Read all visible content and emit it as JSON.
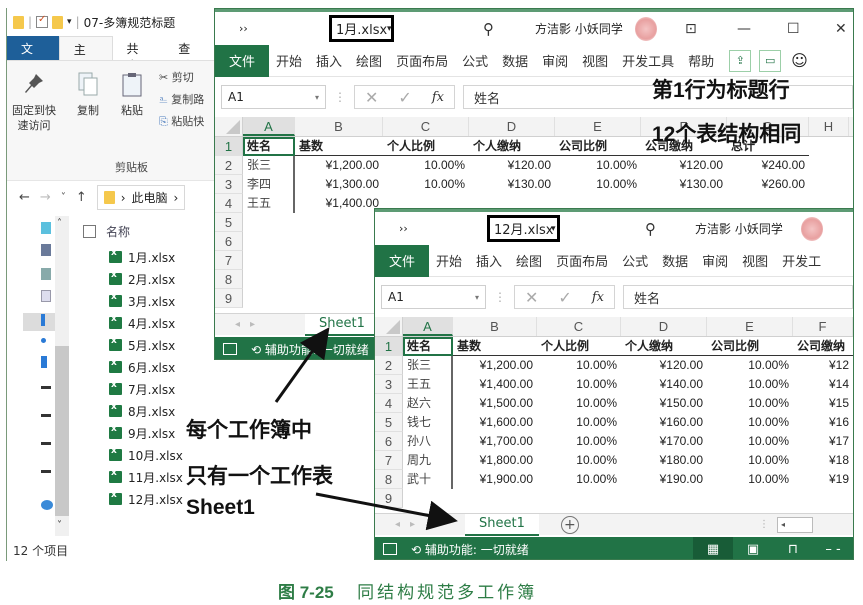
{
  "explorer": {
    "title": "07-多簿规范标题",
    "tabs": [
      "文件",
      "主页",
      "共享",
      "查看"
    ],
    "ribbon": {
      "pin_label_line1": "固定到快",
      "pin_label_line2": "速访问",
      "copy_label": "复制",
      "paste_label": "粘贴",
      "cut_label": "剪切",
      "copy_path_label": "复制路",
      "paste_shortcut_label": "粘贴快",
      "group_label": "剪贴板"
    },
    "nav": {
      "back": "←",
      "forward": "→",
      "recent": "˅",
      "up": "↑",
      "path_item": "此电脑",
      "sep": "›"
    },
    "list_header": "名称",
    "files": [
      "1月.xlsx",
      "2月.xlsx",
      "3月.xlsx",
      "4月.xlsx",
      "5月.xlsx",
      "6月.xlsx",
      "7月.xlsx",
      "8月.xlsx",
      "9月.xlsx",
      "10月.xlsx",
      "11月.xlsx",
      "12月.xlsx"
    ],
    "status": "12 个项目"
  },
  "workbook1": {
    "more": "››",
    "filename": "1月.xlsx",
    "user": "方洁影 小妖同学",
    "window_buttons": {
      "ribbon_display": "⊡",
      "minimize": "—",
      "maximize": "☐",
      "close": "✕"
    },
    "menu": [
      "开始",
      "插入",
      "绘图",
      "页面布局",
      "公式",
      "数据",
      "审阅",
      "视图",
      "开发工具",
      "帮助"
    ],
    "file_tab": "文件",
    "namebox": "A1",
    "formula": "姓名",
    "columns": [
      "A",
      "B",
      "C",
      "D",
      "E",
      "F",
      "G",
      "H"
    ],
    "rows": [
      [
        "姓名",
        "基数",
        "个人比例",
        "个人缴纳",
        "公司比例",
        "公司缴纳",
        "总计"
      ],
      [
        "张三",
        "¥1,200.00",
        "10.00%",
        "¥120.00",
        "10.00%",
        "¥120.00",
        "¥240.00"
      ],
      [
        "李四",
        "¥1,300.00",
        "10.00%",
        "¥130.00",
        "10.00%",
        "¥130.00",
        "¥260.00"
      ],
      [
        "王五",
        "¥1,400.00",
        "",
        "",
        "",
        "",
        ""
      ]
    ],
    "row_numbers": [
      "1",
      "2",
      "3",
      "4",
      "5",
      "6",
      "7",
      "8",
      "9"
    ],
    "sheet_tab": "Sheet1",
    "status": "辅助功能: 一切就绪"
  },
  "workbook2": {
    "more": "››",
    "filename": "12月.xlsx",
    "user": "方洁影 小妖同学",
    "menu": [
      "开始",
      "插入",
      "绘图",
      "页面布局",
      "公式",
      "数据",
      "审阅",
      "视图",
      "开发工"
    ],
    "file_tab": "文件",
    "namebox": "A1",
    "formula": "姓名",
    "columns": [
      "A",
      "B",
      "C",
      "D",
      "E",
      "F"
    ],
    "rows": [
      [
        "姓名",
        "基数",
        "个人比例",
        "个人缴纳",
        "公司比例",
        "公司缴纳"
      ],
      [
        "张三",
        "¥1,200.00",
        "10.00%",
        "¥120.00",
        "10.00%",
        "¥12"
      ],
      [
        "王五",
        "¥1,400.00",
        "10.00%",
        "¥140.00",
        "10.00%",
        "¥14"
      ],
      [
        "赵六",
        "¥1,500.00",
        "10.00%",
        "¥150.00",
        "10.00%",
        "¥15"
      ],
      [
        "钱七",
        "¥1,600.00",
        "10.00%",
        "¥160.00",
        "10.00%",
        "¥16"
      ],
      [
        "孙八",
        "¥1,700.00",
        "10.00%",
        "¥170.00",
        "10.00%",
        "¥17"
      ],
      [
        "周九",
        "¥1,800.00",
        "10.00%",
        "¥180.00",
        "10.00%",
        "¥18"
      ],
      [
        "武十",
        "¥1,900.00",
        "10.00%",
        "¥190.00",
        "10.00%",
        "¥19"
      ]
    ],
    "row_numbers": [
      "1",
      "2",
      "3",
      "4",
      "5",
      "6",
      "7",
      "8",
      "9"
    ],
    "sheet_tab": "Sheet1",
    "add_sheet": "+",
    "status": "辅助功能: 一切就绪"
  },
  "annotations": {
    "title_row": "第1行为标题行",
    "same_structure": "12个表结构相同",
    "each_workbook": "每个工作簿中",
    "one_sheet": "只有一个工作表",
    "sheet_name": "Sheet1"
  },
  "caption": {
    "number": "图 7-25",
    "text": "同结构规范多工作簿"
  },
  "colors": {
    "excel_green": "#217346",
    "explorer_blue": "#1e5f99",
    "caption_green": "#2e7d46"
  }
}
